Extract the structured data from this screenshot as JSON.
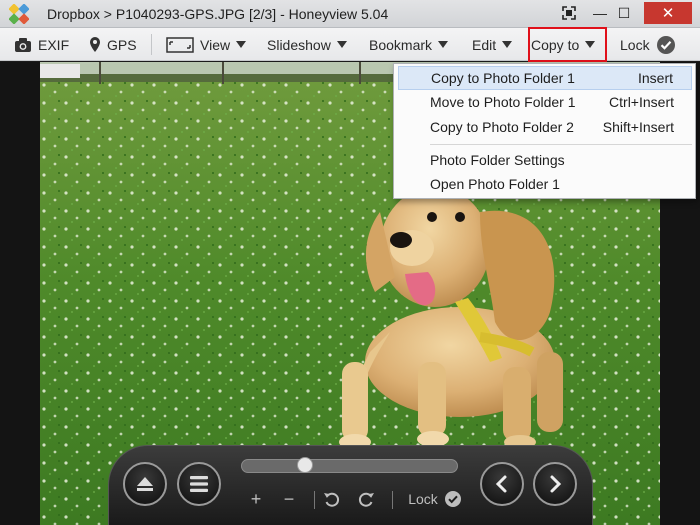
{
  "window": {
    "title": "Dropbox > P1040293-GPS.JPG [2/3] - Honeyview 5.04",
    "close_glyph": "✕",
    "minimize_glyph": "—",
    "maximize_glyph": "☐"
  },
  "toolbar": {
    "exif_label": "EXIF",
    "gps_label": "GPS",
    "view_label": "View",
    "slideshow_label": "Slideshow",
    "bookmark_label": "Bookmark",
    "edit_label": "Edit",
    "copyto_label": "Copy to",
    "lock_label": "Lock"
  },
  "copy_menu": {
    "items": [
      {
        "label": "Copy to Photo Folder 1",
        "shortcut": "Insert",
        "highlighted": true
      },
      {
        "label": "Move to Photo Folder 1",
        "shortcut": "Ctrl+Insert"
      },
      {
        "label": "Copy to Photo Folder 2",
        "shortcut": "Shift+Insert"
      },
      {
        "label": "Photo Folder Settings",
        "shortcut": ""
      },
      {
        "label": "Open Photo Folder 1",
        "shortcut": ""
      }
    ]
  },
  "controls": {
    "plus": "+",
    "minus": "−",
    "lock_label": "Lock",
    "slider_position": 0.28
  },
  "colors": {
    "highlight_border": "#e0101a",
    "menu_highlight": "#dce8f7",
    "close_button": "#c7372f"
  }
}
